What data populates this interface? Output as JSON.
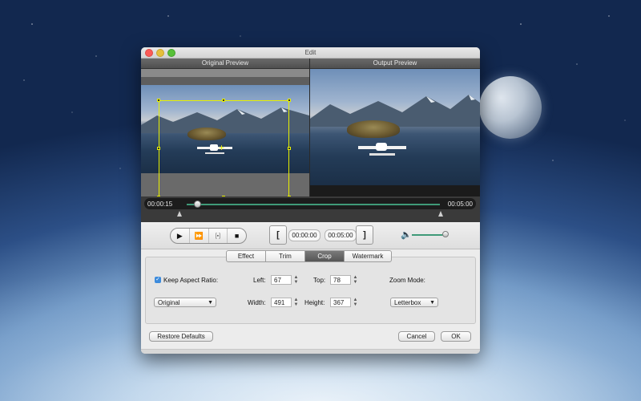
{
  "window": {
    "title": "Edit"
  },
  "preview": {
    "original_label": "Original Preview",
    "output_label": "Output Preview"
  },
  "timeline": {
    "current": "00:00:15",
    "total": "00:05:00",
    "progress": 0.03
  },
  "controls": {
    "play_icon": "play-icon",
    "fast_forward_icon": "fast-forward-icon",
    "snapshot_icon": "frame-snapshot-icon",
    "stop_icon": "stop-icon",
    "start_bracket": "[",
    "start_time": "00:00:00",
    "end_time": "00:05:00",
    "end_bracket": "]",
    "volume_icon": "speaker-icon",
    "volume_level": 0.95,
    "accent_color": "#3f9a78"
  },
  "tabs": [
    {
      "label": "Effect",
      "active": false
    },
    {
      "label": "Trim",
      "active": false
    },
    {
      "label": "Crop",
      "active": true
    },
    {
      "label": "Watermark",
      "active": false
    }
  ],
  "crop": {
    "keep_aspect_label": "Keep Aspect Ratio:",
    "keep_aspect_checked": true,
    "aspect_value": "Original",
    "left_label": "Left:",
    "left_value": "67",
    "top_label": "Top:",
    "top_value": "78",
    "width_label": "Width:",
    "width_value": "491",
    "height_label": "Height:",
    "height_value": "367",
    "zoom_label": "Zoom Mode:",
    "zoom_value": "Letterbox",
    "crop_color": "#e8f000"
  },
  "buttons": {
    "restore": "Restore Defaults",
    "cancel": "Cancel",
    "ok": "OK"
  }
}
